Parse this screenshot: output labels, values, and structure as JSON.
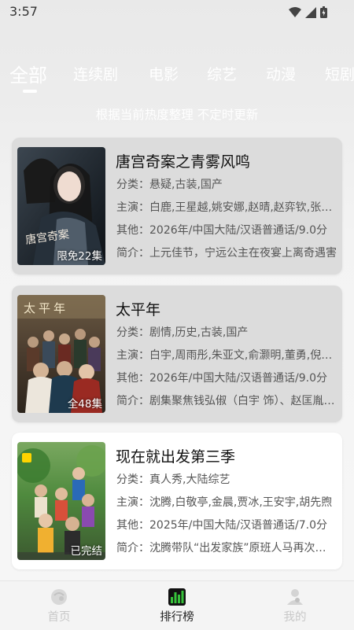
{
  "status": {
    "time": "3:57"
  },
  "tabs": [
    "全部",
    "连续剧",
    "电影",
    "综艺",
    "动漫",
    "短剧"
  ],
  "subtitle": "根据当前热度整理 不定时更新",
  "cards": [
    {
      "title": "唐宫奇案之青雾风鸣",
      "category": "分类：悬疑,古装,国产",
      "cast": "主演：白鹿,王星越,姚安娜,赵晴,赵弈钦,张天阳",
      "other": "其他：2026年/中国大陆/汉语普通话/9.0分",
      "intro": "简介：上元佳节，宁远公主在夜宴上离奇遇害",
      "badge": "限免22集",
      "poster_title": "唐宫奇案"
    },
    {
      "title": "太平年",
      "category": "分类：剧情,历史,古装,国产",
      "cast": "主演：白宇,周雨彤,朱亚文,俞灏明,董勇,倪大红",
      "other": "其他：2026年/中国大陆/汉语普通话/9.0分",
      "intro": "简介：剧集聚焦钱弘俶（白宇 饰）、赵匡胤等人",
      "badge": "全48集",
      "poster_title": "太平年"
    },
    {
      "title": "现在就出发第三季",
      "category": "分类：真人秀,大陆综艺",
      "cast": "主演：沈腾,白敬亭,金晨,贾冰,王安宇,胡先煦",
      "other": "其他：2025年/中国大陆/汉语普通话/7.0分",
      "intro": "简介：沈腾带队“出发家族”原班人马再次出发",
      "badge": "已完结"
    }
  ],
  "nav": [
    {
      "label": "首页",
      "icon": "home-icon"
    },
    {
      "label": "排行榜",
      "icon": "ranking-icon"
    },
    {
      "label": "我的",
      "icon": "profile-icon"
    }
  ]
}
